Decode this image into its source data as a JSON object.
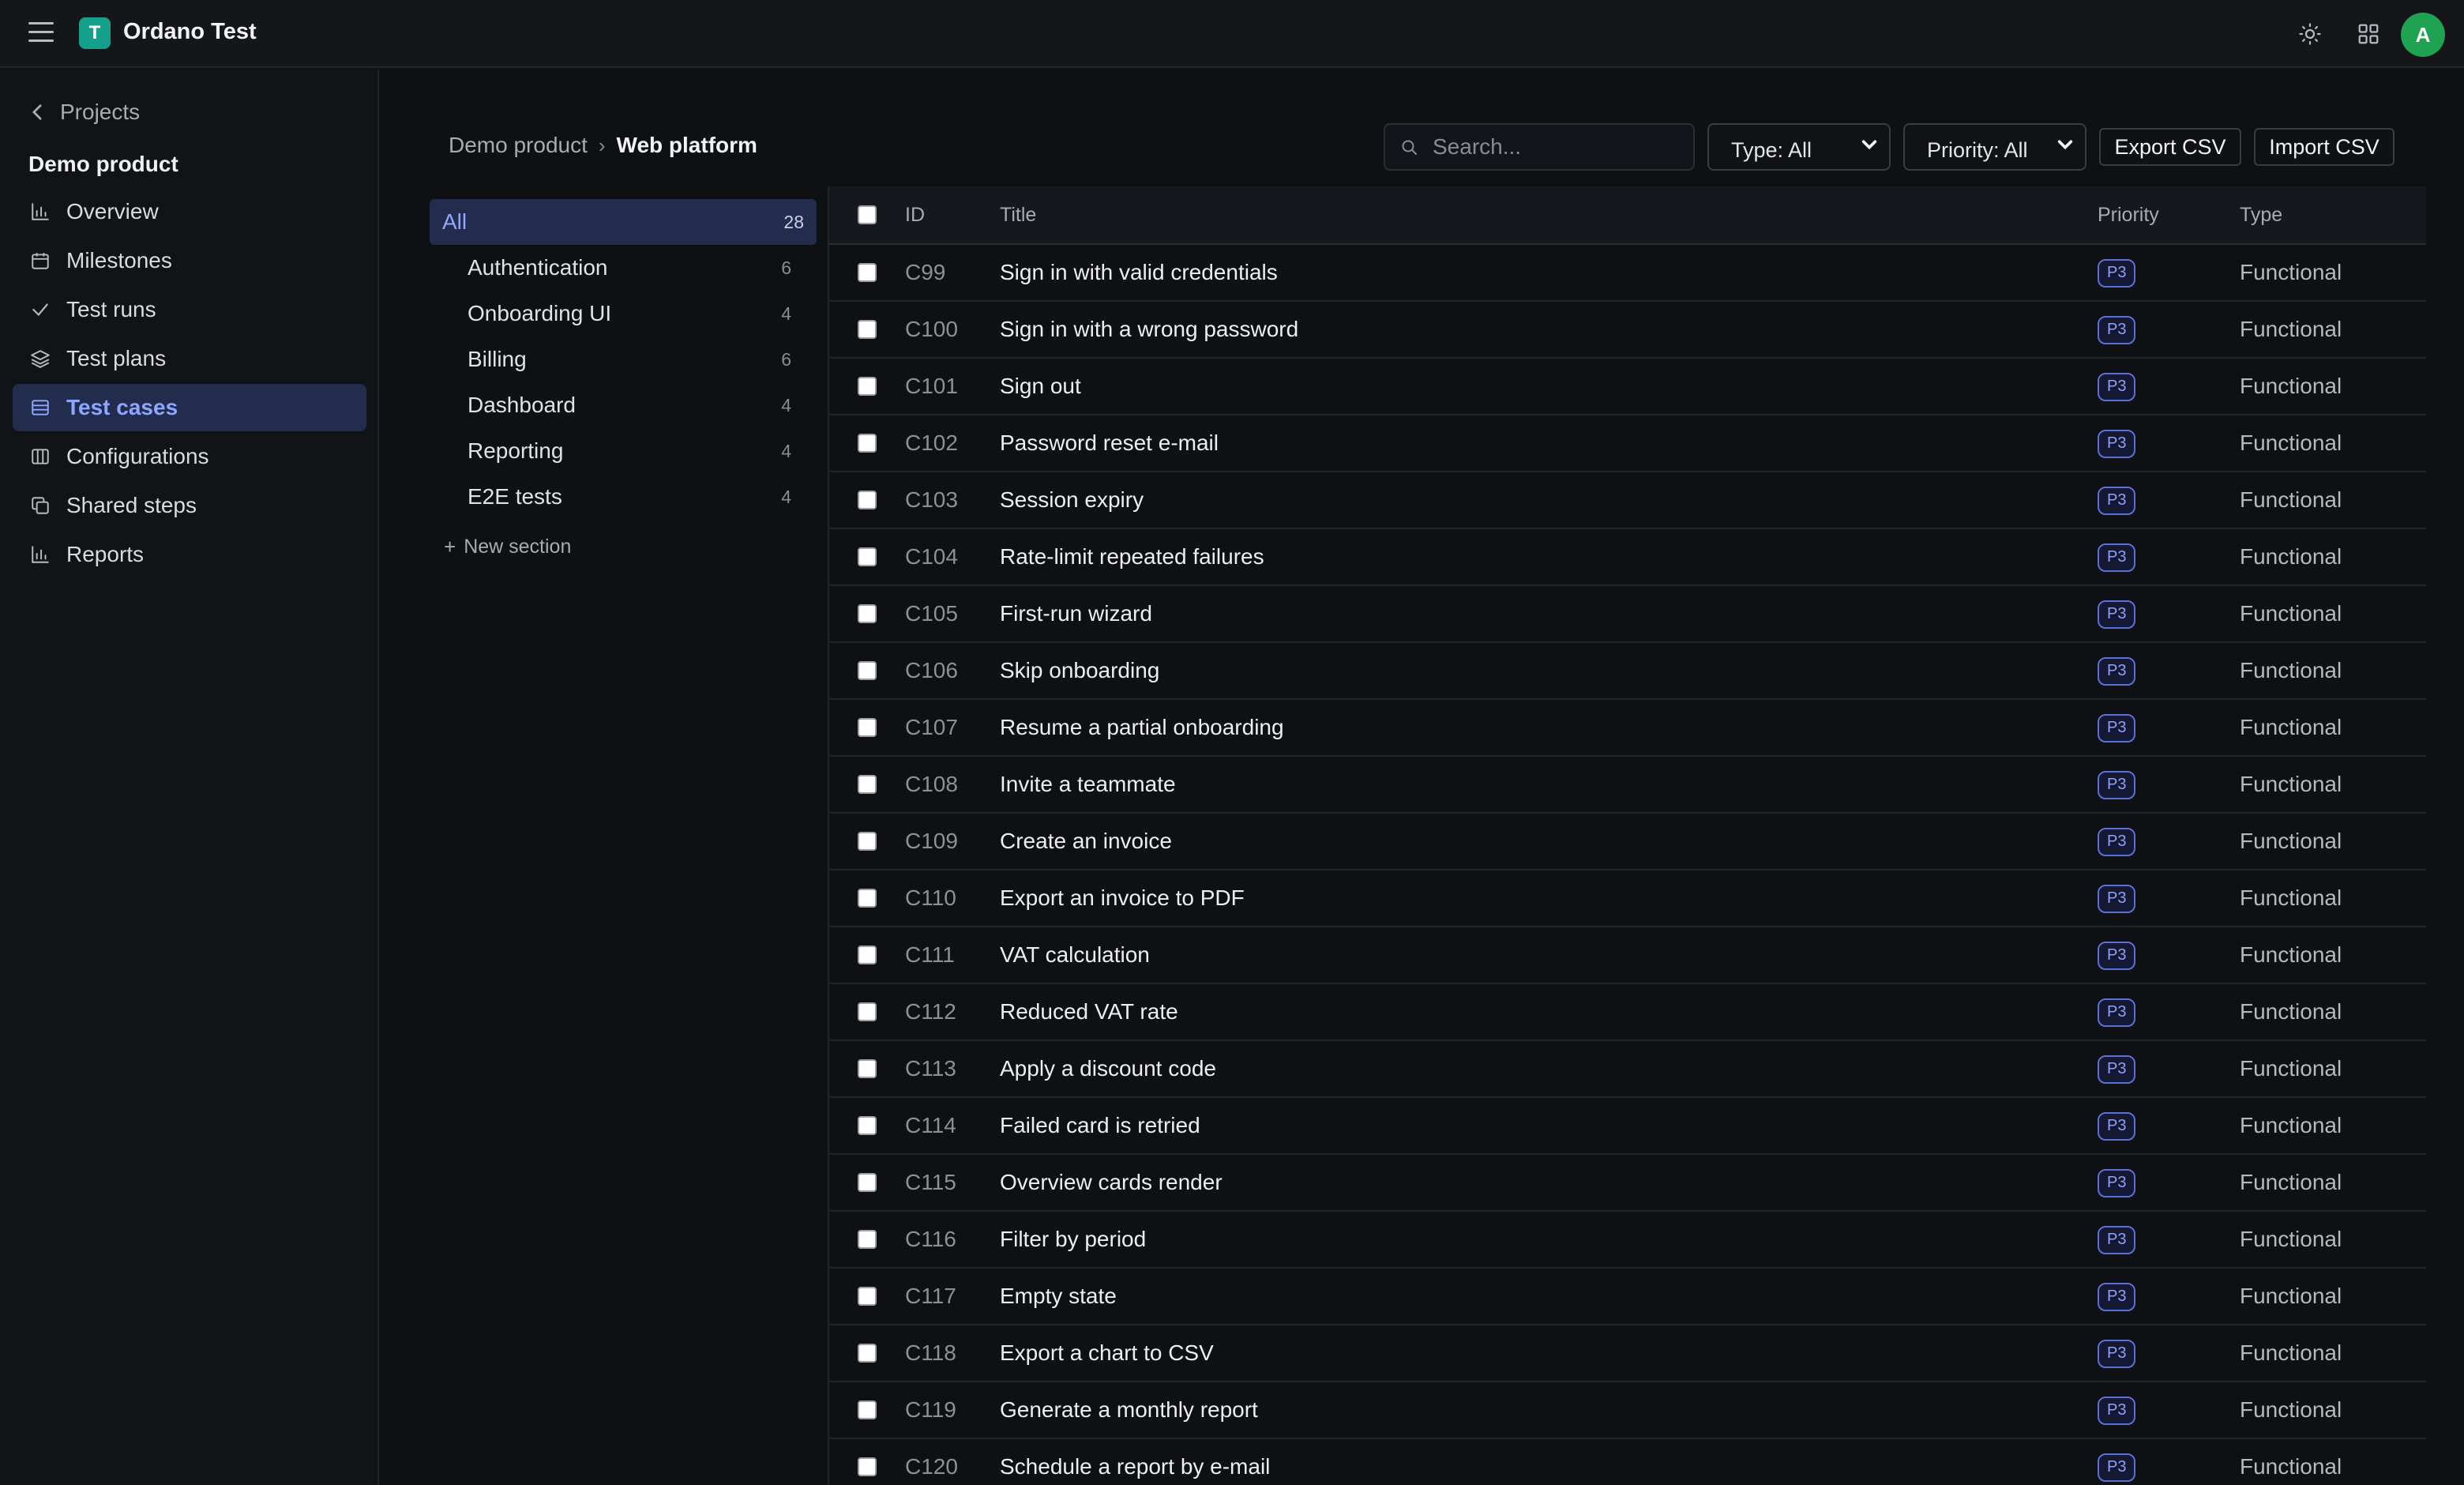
{
  "app": {
    "logo_letter": "T",
    "title": "Ordano Test",
    "avatar_initial": "A"
  },
  "sidebar": {
    "back_label": "Projects",
    "product_name": "Demo product",
    "items": [
      {
        "label": "Overview",
        "icon": "bar-chart-icon",
        "active": false
      },
      {
        "label": "Milestones",
        "icon": "calendar-icon",
        "active": false
      },
      {
        "label": "Test runs",
        "icon": "check-icon",
        "active": false
      },
      {
        "label": "Test plans",
        "icon": "layers-icon",
        "active": false
      },
      {
        "label": "Test cases",
        "icon": "list-icon",
        "active": true
      },
      {
        "label": "Configurations",
        "icon": "columns-icon",
        "active": false
      },
      {
        "label": "Shared steps",
        "icon": "copy-icon",
        "active": false
      },
      {
        "label": "Reports",
        "icon": "bar-chart-icon",
        "active": false
      }
    ]
  },
  "breadcrumb": {
    "parent": "Demo product",
    "current": "Web platform"
  },
  "toolbar": {
    "search_placeholder": "Search...",
    "type_filter": "Type: All",
    "priority_filter": "Priority: All",
    "export_label": "Export CSV",
    "import_label": "Import CSV"
  },
  "sections": {
    "all": {
      "label": "All",
      "count": "28"
    },
    "items": [
      {
        "label": "Authentication",
        "count": "6"
      },
      {
        "label": "Onboarding UI",
        "count": "4"
      },
      {
        "label": "Billing",
        "count": "6"
      },
      {
        "label": "Dashboard",
        "count": "4"
      },
      {
        "label": "Reporting",
        "count": "4"
      },
      {
        "label": "E2E tests",
        "count": "4"
      }
    ],
    "new_label": "New section"
  },
  "table": {
    "headers": {
      "id": "ID",
      "title": "Title",
      "priority": "Priority",
      "type": "Type"
    },
    "rows": [
      {
        "id": "C99",
        "title": "Sign in with valid credentials",
        "priority": "P3",
        "type": "Functional"
      },
      {
        "id": "C100",
        "title": "Sign in with a wrong password",
        "priority": "P3",
        "type": "Functional"
      },
      {
        "id": "C101",
        "title": "Sign out",
        "priority": "P3",
        "type": "Functional"
      },
      {
        "id": "C102",
        "title": "Password reset e-mail",
        "priority": "P3",
        "type": "Functional"
      },
      {
        "id": "C103",
        "title": "Session expiry",
        "priority": "P3",
        "type": "Functional"
      },
      {
        "id": "C104",
        "title": "Rate-limit repeated failures",
        "priority": "P3",
        "type": "Functional"
      },
      {
        "id": "C105",
        "title": "First-run wizard",
        "priority": "P3",
        "type": "Functional"
      },
      {
        "id": "C106",
        "title": "Skip onboarding",
        "priority": "P3",
        "type": "Functional"
      },
      {
        "id": "C107",
        "title": "Resume a partial onboarding",
        "priority": "P3",
        "type": "Functional"
      },
      {
        "id": "C108",
        "title": "Invite a teammate",
        "priority": "P3",
        "type": "Functional"
      },
      {
        "id": "C109",
        "title": "Create an invoice",
        "priority": "P3",
        "type": "Functional"
      },
      {
        "id": "C110",
        "title": "Export an invoice to PDF",
        "priority": "P3",
        "type": "Functional"
      },
      {
        "id": "C111",
        "title": "VAT calculation",
        "priority": "P3",
        "type": "Functional"
      },
      {
        "id": "C112",
        "title": "Reduced VAT rate",
        "priority": "P3",
        "type": "Functional"
      },
      {
        "id": "C113",
        "title": "Apply a discount code",
        "priority": "P3",
        "type": "Functional"
      },
      {
        "id": "C114",
        "title": "Failed card is retried",
        "priority": "P3",
        "type": "Functional"
      },
      {
        "id": "C115",
        "title": "Overview cards render",
        "priority": "P3",
        "type": "Functional"
      },
      {
        "id": "C116",
        "title": "Filter by period",
        "priority": "P3",
        "type": "Functional"
      },
      {
        "id": "C117",
        "title": "Empty state",
        "priority": "P3",
        "type": "Functional"
      },
      {
        "id": "C118",
        "title": "Export a chart to CSV",
        "priority": "P3",
        "type": "Functional"
      },
      {
        "id": "C119",
        "title": "Generate a monthly report",
        "priority": "P3",
        "type": "Functional"
      },
      {
        "id": "C120",
        "title": "Schedule a report by e-mail",
        "priority": "P3",
        "type": "Functional"
      }
    ]
  },
  "colors": {
    "accent": "#8fa6ff",
    "active_bg": "#222c4d",
    "logo": "#14a08a",
    "avatar": "#1fa353"
  }
}
